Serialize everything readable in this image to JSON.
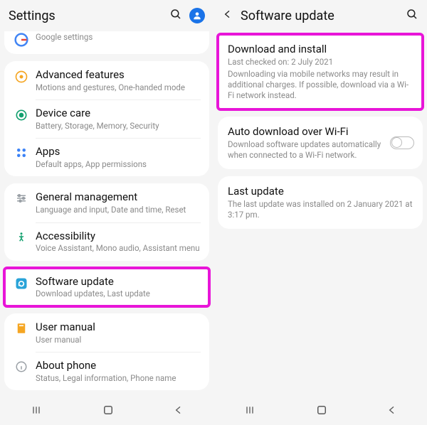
{
  "left": {
    "title": "Settings",
    "google_sub": "Google settings",
    "items": [
      {
        "title": "Advanced features",
        "sub": "Motions and gestures, One-handed mode"
      },
      {
        "title": "Device care",
        "sub": "Battery, Storage, Memory, Security"
      },
      {
        "title": "Apps",
        "sub": "Default apps, App permissions"
      },
      {
        "title": "General management",
        "sub": "Language and input, Date and time, Reset"
      },
      {
        "title": "Accessibility",
        "sub": "Voice Assistant, Mono audio, Assistant menu"
      },
      {
        "title": "Software update",
        "sub": "Download updates, Last update"
      },
      {
        "title": "User manual",
        "sub": "User manual"
      },
      {
        "title": "About phone",
        "sub": "Status, Legal information, Phone name"
      }
    ]
  },
  "right": {
    "title": "Software update",
    "items": [
      {
        "title": "Download and install",
        "sub_line1": "Last checked on: 2 July 2021",
        "sub_line2": "Downloading via mobile networks may result in additional charges. If possible, download via a Wi-Fi network instead."
      },
      {
        "title": "Auto download over Wi-Fi",
        "sub": "Download software updates automatically when connected to a Wi-Fi network."
      },
      {
        "title": "Last update",
        "sub": "The last update was installed on 2 January 2021 at 3:17 pm."
      }
    ]
  },
  "colors": {
    "highlight": "#e815d8",
    "accent": "#1a73e8"
  }
}
